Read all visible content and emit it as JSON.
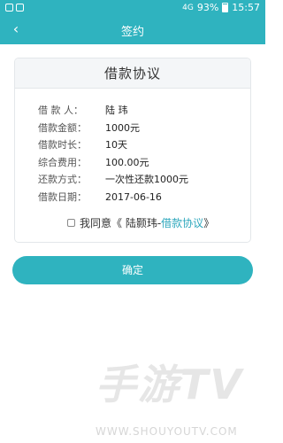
{
  "status_bar": {
    "signal_text": "4G",
    "battery_percent": "93%",
    "time": "15:57"
  },
  "nav": {
    "back_icon": "‹",
    "title": "签约"
  },
  "agreement_card": {
    "title": "借款协议",
    "rows": [
      {
        "label": "借 款 人：",
        "value": "陆  玮"
      },
      {
        "label": "借款金额：",
        "value": "1000元"
      },
      {
        "label": "借款时长：",
        "value": "10天"
      },
      {
        "label": "综合费用：",
        "value": " 100.00元"
      },
      {
        "label": "还款方式：",
        "value": "一次性还款1000元"
      },
      {
        "label": "借款日期：",
        "value": "2017-06-16"
      }
    ]
  },
  "consent": {
    "prefix": "我同意",
    "open_quote": "《 陆颢玮-",
    "link": "借款协议",
    "close_quote": " 》"
  },
  "confirm_button": "确定",
  "watermark": {
    "logo_text": "手游TV",
    "url": "WWW.SHOUYOUTV.COM"
  },
  "colors": {
    "primary": "#2fb3bf",
    "link": "#2fa8bd"
  }
}
